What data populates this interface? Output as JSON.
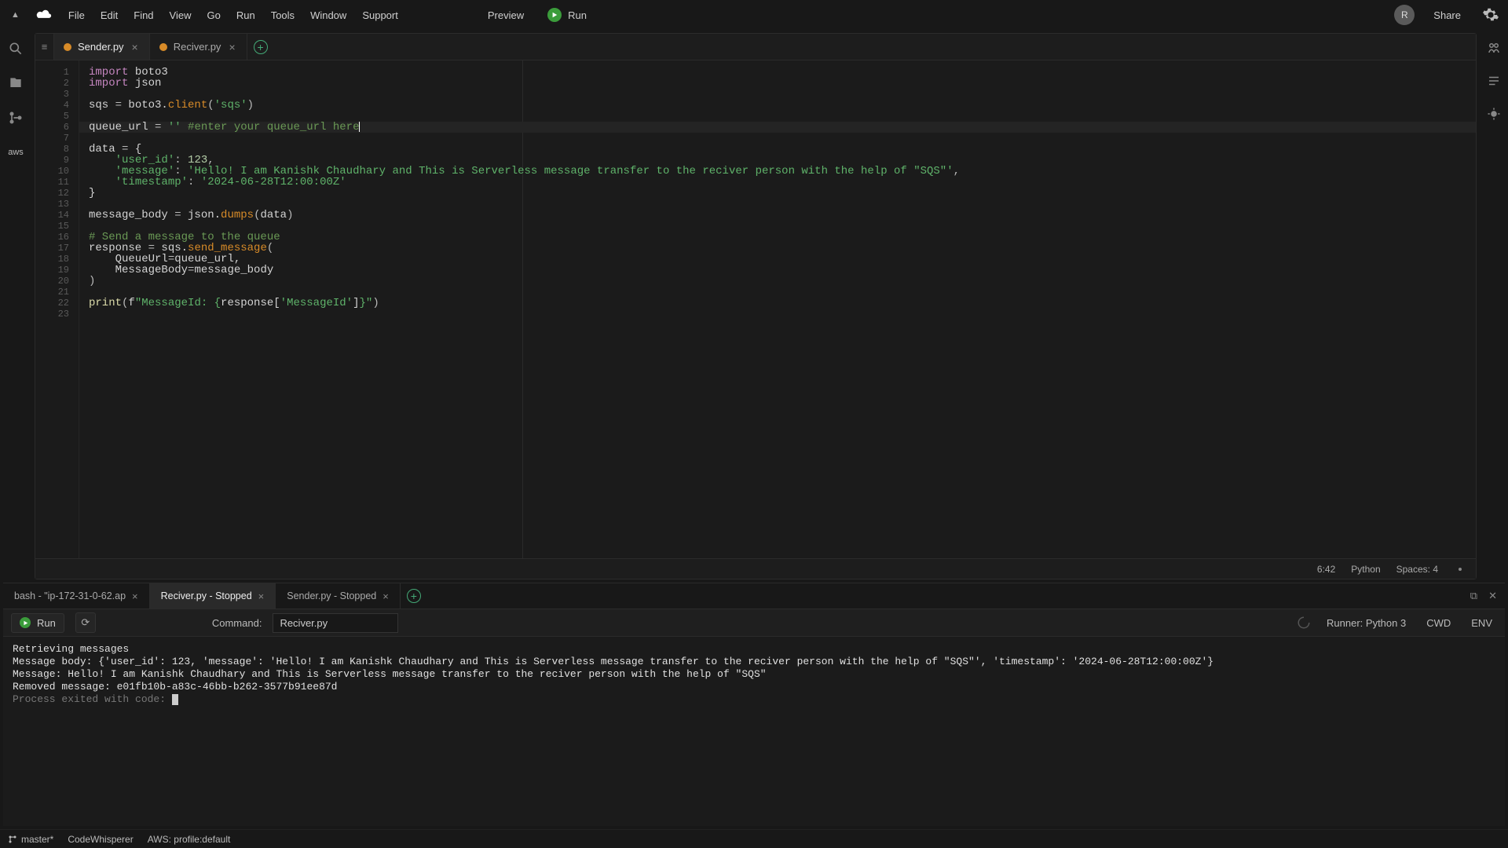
{
  "menubar": {
    "items": [
      "File",
      "Edit",
      "Find",
      "View",
      "Go",
      "Run",
      "Tools",
      "Window",
      "Support"
    ],
    "preview": "Preview",
    "run": "Run",
    "share": "Share",
    "avatar_initial": "R"
  },
  "activity": {
    "aws": "aws"
  },
  "tabs": [
    {
      "label": "Sender.py",
      "active": true
    },
    {
      "label": "Reciver.py",
      "active": false
    }
  ],
  "code": {
    "lines": [
      {
        "n": 1,
        "segs": [
          [
            "kw",
            "import"
          ],
          [
            "id",
            " boto3"
          ]
        ]
      },
      {
        "n": 2,
        "segs": [
          [
            "kw",
            "import"
          ],
          [
            "id",
            " json"
          ]
        ]
      },
      {
        "n": 3,
        "segs": []
      },
      {
        "n": 4,
        "segs": [
          [
            "id",
            "sqs "
          ],
          [
            "op",
            "="
          ],
          [
            "id",
            " boto3."
          ],
          [
            "fn2",
            "client"
          ],
          [
            "op",
            "("
          ],
          [
            "str",
            "'sqs'"
          ],
          [
            "op",
            ")"
          ]
        ]
      },
      {
        "n": 5,
        "segs": []
      },
      {
        "n": 6,
        "hl": true,
        "segs": [
          [
            "id",
            "queue_url "
          ],
          [
            "op",
            "="
          ],
          [
            "id",
            " "
          ],
          [
            "str",
            "''"
          ],
          [
            "id",
            " "
          ],
          [
            "cmt",
            "#enter your queue_url here"
          ],
          [
            "caret",
            ""
          ]
        ]
      },
      {
        "n": 7,
        "segs": []
      },
      {
        "n": 8,
        "segs": [
          [
            "id",
            "data "
          ],
          [
            "op",
            "="
          ],
          [
            "id",
            " {"
          ]
        ]
      },
      {
        "n": 9,
        "segs": [
          [
            "id",
            "    "
          ],
          [
            "str",
            "'user_id'"
          ],
          [
            "op",
            ": "
          ],
          [
            "num",
            "123"
          ],
          [
            "op",
            ","
          ]
        ]
      },
      {
        "n": 10,
        "segs": [
          [
            "id",
            "    "
          ],
          [
            "str",
            "'message'"
          ],
          [
            "op",
            ": "
          ],
          [
            "str",
            "'Hello! I am Kanishk Chaudhary and This is Serverless message transfer to the reciver person with the help of \"SQS\"'"
          ],
          [
            "op",
            ","
          ]
        ]
      },
      {
        "n": 11,
        "segs": [
          [
            "id",
            "    "
          ],
          [
            "str",
            "'timestamp'"
          ],
          [
            "op",
            ": "
          ],
          [
            "str",
            "'2024-06-28T12:00:00Z'"
          ]
        ]
      },
      {
        "n": 12,
        "segs": [
          [
            "id",
            "}"
          ]
        ]
      },
      {
        "n": 13,
        "segs": []
      },
      {
        "n": 14,
        "segs": [
          [
            "id",
            "message_body "
          ],
          [
            "op",
            "="
          ],
          [
            "id",
            " json."
          ],
          [
            "fn2",
            "dumps"
          ],
          [
            "op",
            "("
          ],
          [
            "id",
            "data"
          ],
          [
            "op",
            ")"
          ]
        ]
      },
      {
        "n": 15,
        "segs": []
      },
      {
        "n": 16,
        "segs": [
          [
            "cmt",
            "# Send a message to the queue"
          ]
        ]
      },
      {
        "n": 17,
        "segs": [
          [
            "id",
            "response "
          ],
          [
            "op",
            "="
          ],
          [
            "id",
            " sqs."
          ],
          [
            "fn2",
            "send_message"
          ],
          [
            "op",
            "("
          ]
        ]
      },
      {
        "n": 18,
        "segs": [
          [
            "id",
            "    QueueUrl"
          ],
          [
            "op",
            "="
          ],
          [
            "id",
            "queue_url,"
          ]
        ]
      },
      {
        "n": 19,
        "segs": [
          [
            "id",
            "    MessageBody"
          ],
          [
            "op",
            "="
          ],
          [
            "id",
            "message_body"
          ]
        ]
      },
      {
        "n": 20,
        "segs": [
          [
            "op",
            ")"
          ]
        ]
      },
      {
        "n": 21,
        "segs": []
      },
      {
        "n": 22,
        "segs": [
          [
            "fn",
            "print"
          ],
          [
            "op",
            "("
          ],
          [
            "id",
            "f"
          ],
          [
            "str",
            "\"MessageId: {"
          ],
          [
            "id",
            "response["
          ],
          [
            "str",
            "'MessageId'"
          ],
          [
            "id",
            "]"
          ],
          [
            "str",
            "}\""
          ],
          [
            "op",
            ")"
          ]
        ]
      },
      {
        "n": 23,
        "segs": []
      }
    ]
  },
  "editor_status": {
    "pos": "6:42",
    "lang": "Python",
    "spaces": "Spaces: 4"
  },
  "panel_tabs": [
    {
      "label": "bash - \"ip-172-31-0-62.ap",
      "active": false,
      "closable": true
    },
    {
      "label": "Reciver.py - Stopped",
      "active": true,
      "closable": true
    },
    {
      "label": "Sender.py - Stopped",
      "active": false,
      "closable": true
    }
  ],
  "panel_toolbar": {
    "run": "Run",
    "command_label": "Command:",
    "command_value": "Reciver.py",
    "runner": "Runner: Python 3",
    "cwd": "CWD",
    "env": "ENV"
  },
  "console_lines": [
    "Retrieving messages",
    "Message body: {'user_id': 123, 'message': 'Hello! I am Kanishk Chaudhary and This is Serverless message transfer to the reciver person with the help of \"SQS\"', 'timestamp': '2024-06-28T12:00:00Z'}",
    "Message: Hello! I am Kanishk Chaudhary and This is Serverless message transfer to the reciver person with the help of \"SQS\"",
    "Removed message: e01fb10b-a83c-46bb-b262-3577b91ee87d",
    "",
    ""
  ],
  "console_exit": "Process exited with code: ",
  "footer": {
    "branch": "master*",
    "codewhisperer": "CodeWhisperer",
    "aws_profile": "AWS: profile:default"
  }
}
